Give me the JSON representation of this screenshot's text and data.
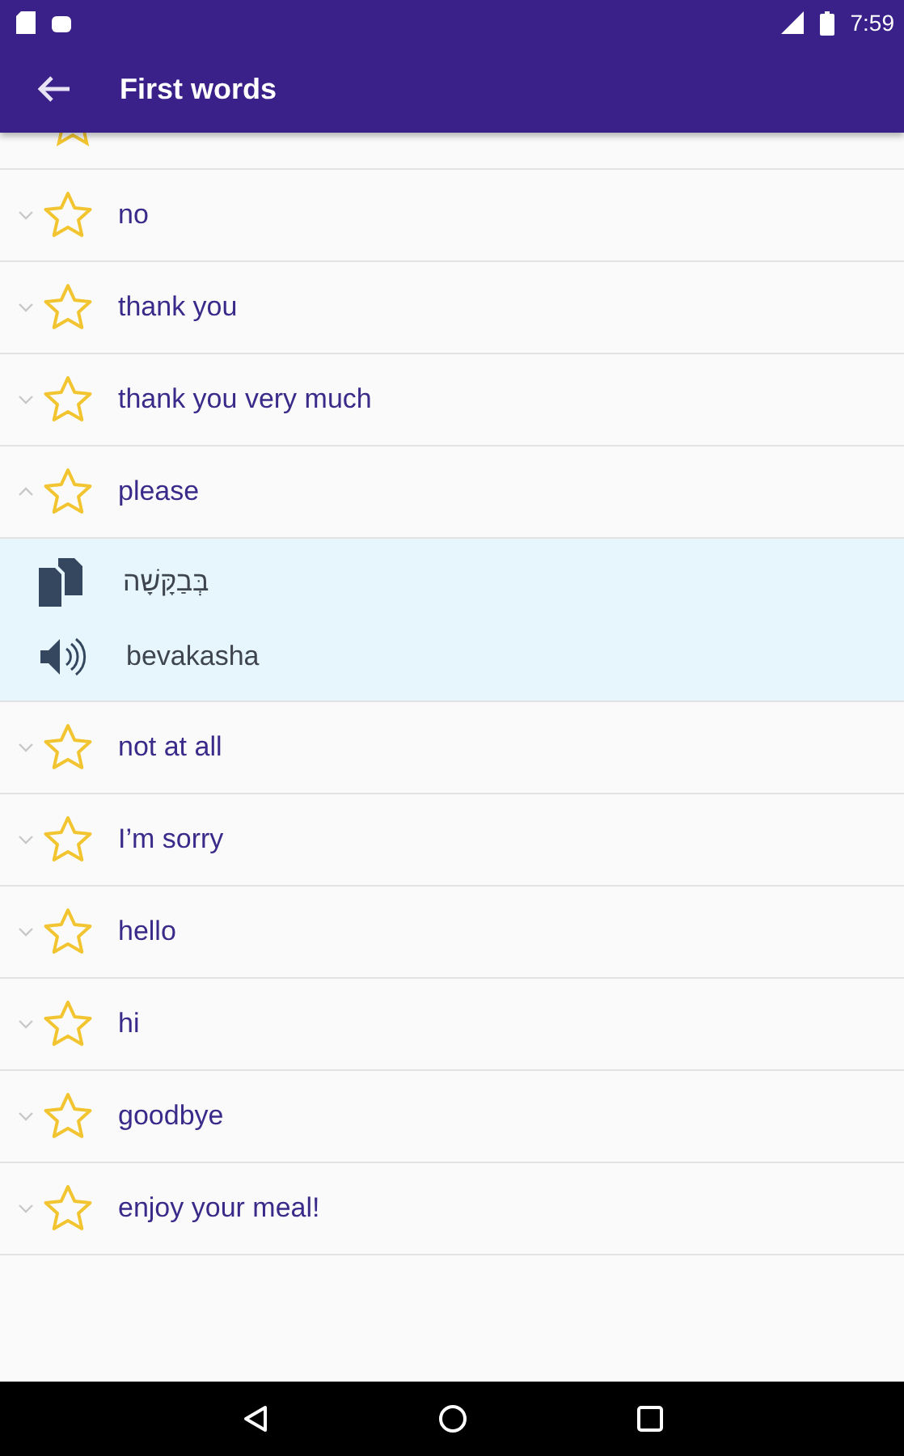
{
  "status_bar": {
    "time": "7:59"
  },
  "app_bar": {
    "title": "First words"
  },
  "words": [
    {
      "word": "no",
      "expanded": false,
      "starred": false
    },
    {
      "word": "thank you",
      "expanded": false,
      "starred": false
    },
    {
      "word": "thank you very much",
      "expanded": false,
      "starred": false
    },
    {
      "word": "please",
      "expanded": true,
      "starred": false,
      "translation": "בְּבַקָּשָׁה",
      "transliteration": "bevakasha"
    },
    {
      "word": "not at all",
      "expanded": false,
      "starred": false
    },
    {
      "word": "I’m sorry",
      "expanded": false,
      "starred": false
    },
    {
      "word": "hello",
      "expanded": false,
      "starred": false
    },
    {
      "word": "hi",
      "expanded": false,
      "starred": false
    },
    {
      "word": "goodbye",
      "expanded": false,
      "starred": false
    },
    {
      "word": "enjoy your meal!",
      "expanded": false,
      "starred": false
    }
  ]
}
